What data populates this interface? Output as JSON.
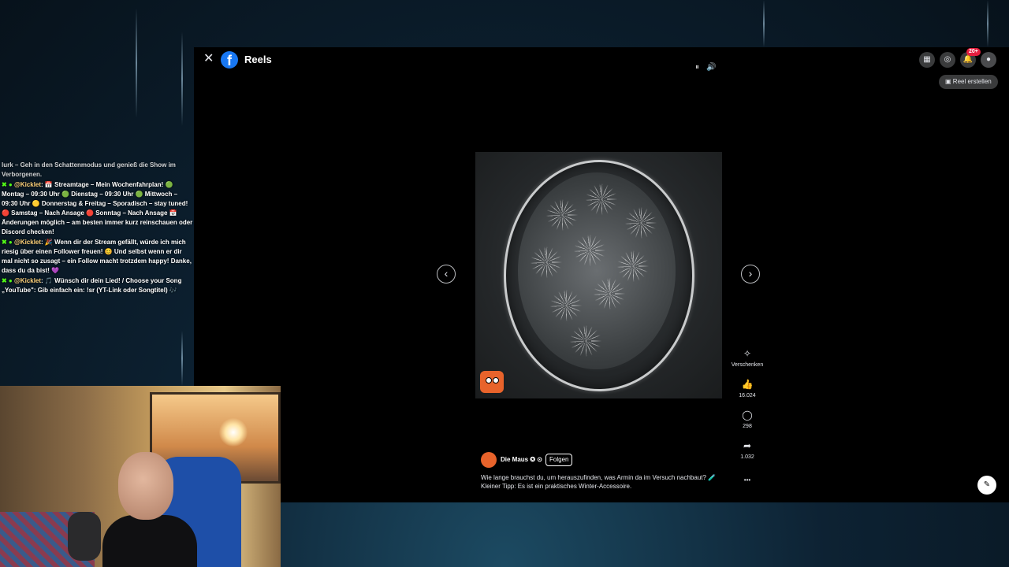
{
  "chat": {
    "messages": [
      {
        "user": "",
        "text": "lurk – Geh in den Schattenmodus und genieß die Show im Verborgenen."
      },
      {
        "user": "@Kicklet",
        "text": ": 📅 Streamtage – Mein Wochenfahrplan! 🟢 Montag – 09:30 Uhr 🟢 Dienstag – 09:30 Uhr 🟢 Mittwoch – 09:30 Uhr 🟡 Donnerstag & Freitag – Sporadisch – stay tuned! 🔴 Samstag – Nach Ansage 🔴 Sonntag – Nach Ansage 📅 Änderungen möglich – am besten immer kurz reinschauen oder Discord checken!"
      },
      {
        "user": "@Kicklet",
        "text": ": 🎉 Wenn dir der Stream gefällt, würde ich mich riesig über einen Follower freuen! 😊 Und selbst wenn er dir mal nicht so zusagt – ein Follow macht trotzdem happy! Danke, dass du da bist! 💜"
      },
      {
        "user": "@Kicklet",
        "text": ": 🎵 Wünsch dir dein Lied! / Choose your Song „YouTube\": Gib einfach ein: !sr (YT-Link oder Songtitel) 🎶"
      }
    ]
  },
  "header": {
    "title": "Reels",
    "close_icon": "✕",
    "logo": "f",
    "notification_badge": "20+",
    "reel_create_label": "Reel erstellen"
  },
  "player": {
    "prev_icon": "‹",
    "next_icon": "›"
  },
  "actions": {
    "gift_label": "Verschenken",
    "likes": "16.024",
    "comments": "298",
    "shares": "1.032",
    "more": "•••"
  },
  "post": {
    "author": "Die Maus ✪ ⊙",
    "follow_label": "Folgen",
    "caption": "Wie lange brauchst du, um herauszufinden, was Armin da im Versuch nachbaut? 🧪 Kleiner Tipp: Es ist ein praktisches Winter-Accessoire."
  },
  "colors": {
    "facebook_blue": "#1877f2",
    "maus_orange": "#e8632b",
    "badge_red": "#e41e3f"
  }
}
